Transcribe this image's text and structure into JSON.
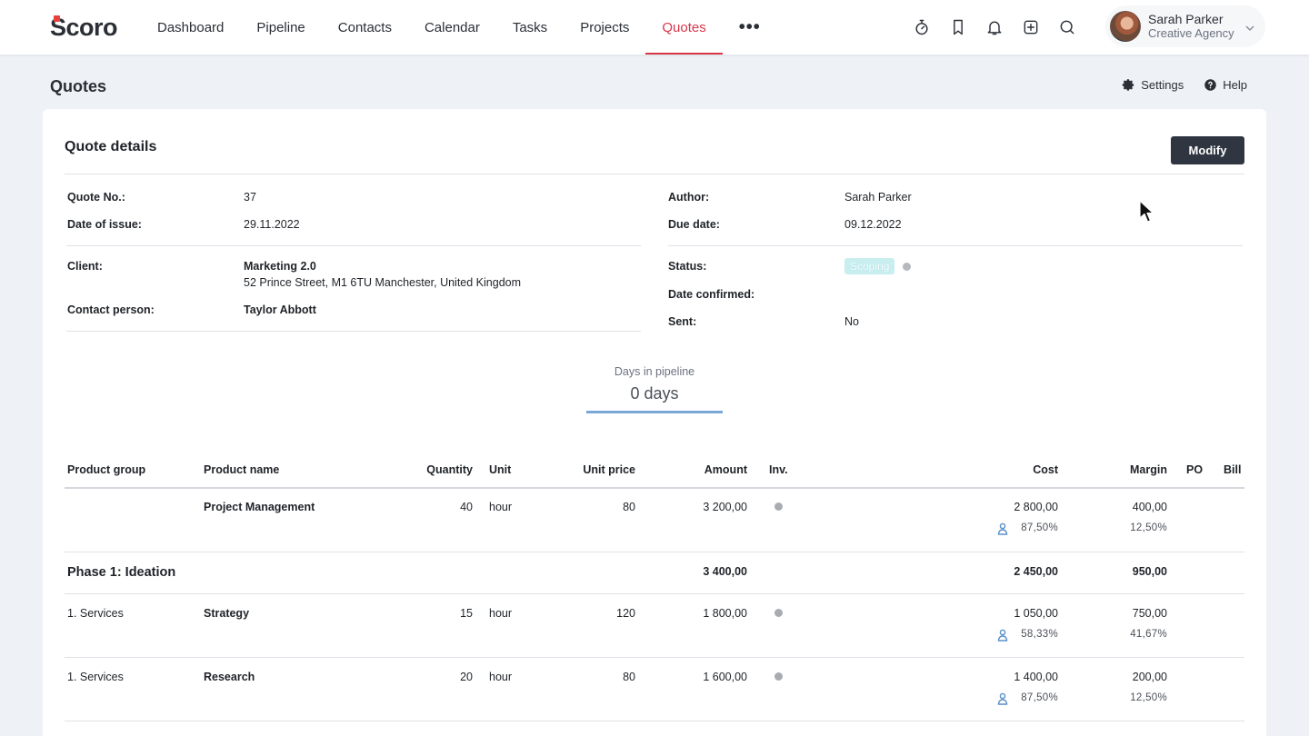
{
  "app": {
    "logo": "Scoro"
  },
  "nav": {
    "items": [
      "Dashboard",
      "Pipeline",
      "Contacts",
      "Calendar",
      "Tasks",
      "Projects",
      "Quotes"
    ],
    "active_index": 6,
    "more": "•••"
  },
  "header_icons": [
    "timer-icon",
    "bookmark-icon",
    "bell-icon",
    "add-icon",
    "search-icon"
  ],
  "user": {
    "name": "Sarah Parker",
    "org": "Creative Agency"
  },
  "page": {
    "title": "Quotes",
    "settings_label": "Settings",
    "help_label": "Help"
  },
  "quote": {
    "section_title": "Quote details",
    "modify_label": "Modify",
    "fields": {
      "quote_no_label": "Quote No.:",
      "quote_no": "37",
      "date_of_issue_label": "Date of issue:",
      "date_of_issue": "29.11.2022",
      "author_label": "Author:",
      "author": "Sarah Parker",
      "due_date_label": "Due date:",
      "due_date": "09.12.2022",
      "client_label": "Client:",
      "client_name": "Marketing 2.0",
      "client_address": "52 Prince Street, M1 6TU Manchester, United Kingdom",
      "contact_person_label": "Contact person:",
      "contact_person": "Taylor Abbott",
      "status_label": "Status:",
      "status": "Scoping",
      "date_confirmed_label": "Date confirmed:",
      "date_confirmed": "",
      "sent_label": "Sent:",
      "sent": "No"
    },
    "pipeline": {
      "label": "Days in pipeline",
      "value": "0 days"
    }
  },
  "table": {
    "headers": {
      "product_group": "Product group",
      "product_name": "Product name",
      "quantity": "Quantity",
      "unit": "Unit",
      "unit_price": "Unit price",
      "amount": "Amount",
      "inv": "Inv.",
      "cost": "Cost",
      "margin": "Margin",
      "po": "PO",
      "bill": "Bill"
    },
    "rows": [
      {
        "group": "",
        "name": "Project Management",
        "quantity": "40",
        "unit": "hour",
        "unit_price": "80",
        "amount": "3 200,00",
        "cost": "2 800,00",
        "cost_pct": "87,50%",
        "margin": "400,00",
        "margin_pct": "12,50%"
      },
      {
        "group": "1. Services",
        "name": "Strategy",
        "quantity": "15",
        "unit": "hour",
        "unit_price": "120",
        "amount": "1 800,00",
        "cost": "1 050,00",
        "cost_pct": "58,33%",
        "margin": "750,00",
        "margin_pct": "41,67%"
      },
      {
        "group": "1. Services",
        "name": "Research",
        "quantity": "20",
        "unit": "hour",
        "unit_price": "80",
        "amount": "1 600,00",
        "cost": "1 400,00",
        "cost_pct": "87,50%",
        "margin": "200,00",
        "margin_pct": "12,50%"
      }
    ],
    "phase": {
      "title": "Phase 1: Ideation",
      "amount": "3 400,00",
      "cost": "2 450,00",
      "margin": "950,00"
    }
  },
  "colors": {
    "accent": "#d8374b",
    "button_dark": "#2f3541",
    "status_badge": "#c9eef0",
    "pipeline_bar": "#7aa7d6"
  }
}
